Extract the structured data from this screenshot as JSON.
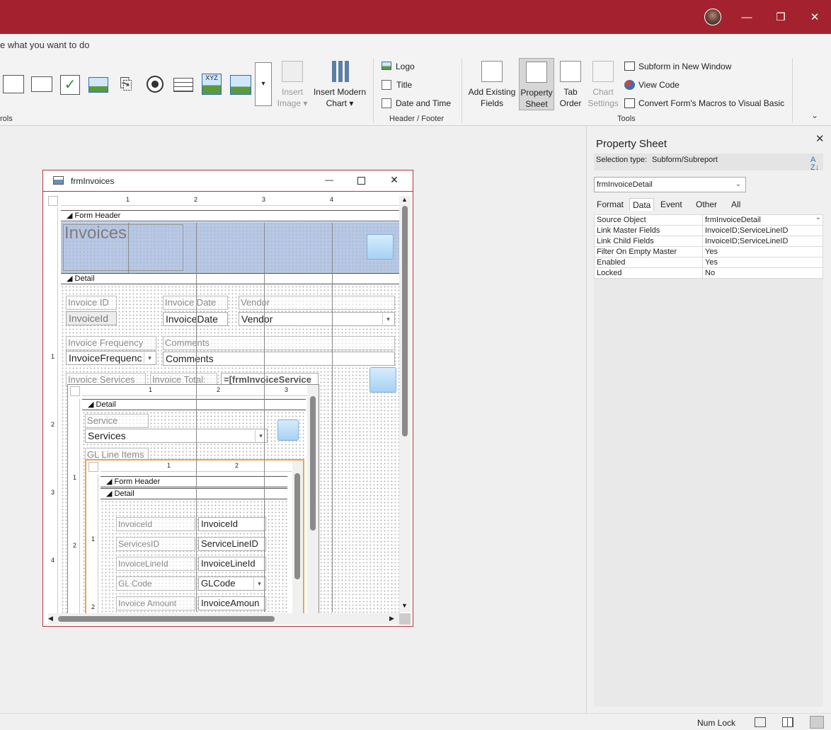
{
  "window": {
    "controls": {
      "minimize": "—",
      "restore": "❐",
      "close": "✕"
    }
  },
  "tellme": {
    "text": "e what you want to do"
  },
  "ribbon": {
    "controls_group_label": "rols",
    "insert_image": [
      "Insert",
      "Image"
    ],
    "insert_chart": [
      "Insert Modern",
      "Chart"
    ],
    "header_footer": {
      "logo": "Logo",
      "title": "Title",
      "date_time": "Date and Time",
      "group_label": "Header / Footer"
    },
    "tools": {
      "add_existing": [
        "Add Existing",
        "Fields"
      ],
      "property_sheet": [
        "Property",
        "Sheet"
      ],
      "tab_order": [
        "Tab",
        "Order"
      ],
      "chart_settings": [
        "Chart",
        "Settings"
      ],
      "subform_new_window": "Subform in New Window",
      "view_code": "View Code",
      "convert_macros": "Convert Form's Macros to Visual Basic",
      "group_label": "Tools"
    }
  },
  "form_window": {
    "title": "frmInvoices",
    "ruler_marks": [
      "1",
      "2",
      "3",
      "4"
    ],
    "vruler_marks": [
      "1",
      "2",
      "3",
      "4"
    ],
    "sections": {
      "form_header": "Form Header",
      "detail": "Detail"
    },
    "header_title": "Invoices",
    "controls": {
      "invoice_id_label": "Invoice ID",
      "invoice_id_box": "InvoiceId",
      "invoice_date_label": "Invoice Date",
      "invoice_date_box": "InvoiceDate",
      "vendor_label": "Vendor",
      "vendor_box": "Vendor",
      "frequency_label": "Invoice Frequency",
      "frequency_box": "InvoiceFrequenc",
      "comments_label": "Comments",
      "comments_box": "Comments",
      "services_label": "Invoice Services",
      "total_label": "Invoice Total:",
      "total_box": "=[frmInvoiceService"
    },
    "subform1": {
      "ruler_marks": [
        "1",
        "2",
        "3"
      ],
      "vruler_marks": [
        "1",
        "2"
      ],
      "detail": "Detail",
      "service_label": "Service",
      "service_box": "Services",
      "gl_label": "GL Line Items"
    },
    "subform2": {
      "ruler_marks": [
        "1",
        "2"
      ],
      "vruler_marks": [
        "1",
        "2"
      ],
      "form_header": "Form Header",
      "detail": "Detail",
      "rows": [
        {
          "label": "InvoiceId",
          "box": "InvoiceId",
          "combo": false
        },
        {
          "label": "ServicesID",
          "box": "ServiceLineID",
          "combo": false
        },
        {
          "label": "InvoiceLineId",
          "box": "InvoiceLineId",
          "combo": false
        },
        {
          "label": "GL Code",
          "box": "GLCode",
          "combo": true
        },
        {
          "label": "Invoice Amount",
          "box": "InvoiceAmoun",
          "combo": false
        }
      ]
    }
  },
  "property_sheet": {
    "title": "Property Sheet",
    "selection_type": "Selection type:",
    "selection_value": "Subform/Subreport",
    "object_selector": "frmInvoiceDetail",
    "tabs": [
      "Format",
      "Data",
      "Event",
      "Other",
      "All"
    ],
    "active_tab": "Data",
    "properties": [
      {
        "name": "Source Object",
        "value": "frmInvoiceDetail"
      },
      {
        "name": "Link Master Fields",
        "value": "InvoiceID;ServiceLineID"
      },
      {
        "name": "Link Child Fields",
        "value": "InvoiceID;ServiceLineID"
      },
      {
        "name": "Filter On Empty Master",
        "value": "Yes"
      },
      {
        "name": "Enabled",
        "value": "Yes"
      },
      {
        "name": "Locked",
        "value": "No"
      }
    ]
  },
  "status": {
    "num_lock": "Num Lock"
  }
}
